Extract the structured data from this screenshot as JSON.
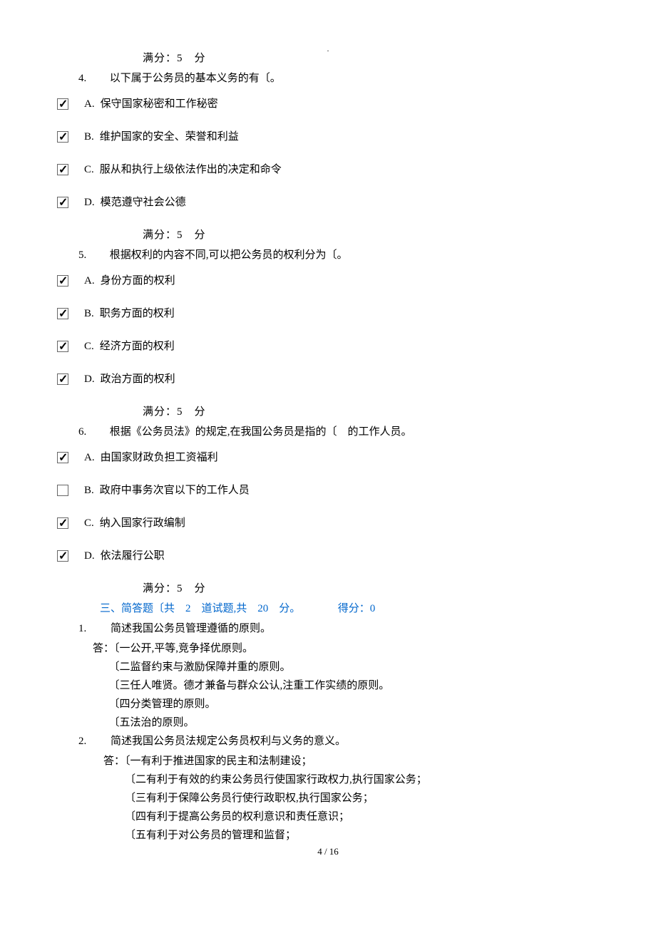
{
  "topDot": ".",
  "questions": [
    {
      "scoreLine": "满分：5　分",
      "num": "4.",
      "text": "以下属于公务员的基本义务的有〔。",
      "options": [
        {
          "checked": true,
          "letter": "A.",
          "text": "保守国家秘密和工作秘密"
        },
        {
          "checked": true,
          "letter": "B.",
          "text": "维护国家的安全、荣誉和利益"
        },
        {
          "checked": true,
          "letter": "C.",
          "text": "服从和执行上级依法作出的决定和命令"
        },
        {
          "checked": true,
          "letter": "D.",
          "text": "模范遵守社会公德"
        }
      ]
    },
    {
      "scoreLine": "满分：5　分",
      "num": "5.",
      "text": "根据权利的内容不同,可以把公务员的权利分为〔。",
      "options": [
        {
          "checked": true,
          "letter": "A.",
          "text": "身份方面的权利"
        },
        {
          "checked": true,
          "letter": "B.",
          "text": "职务方面的权利"
        },
        {
          "checked": true,
          "letter": "C.",
          "text": "经济方面的权利"
        },
        {
          "checked": true,
          "letter": "D.",
          "text": "政治方面的权利"
        }
      ]
    },
    {
      "scoreLine": "满分：5　分",
      "num": "6.",
      "text": "根据《公务员法》的规定,在我国公务员是指的〔　的工作人员。",
      "options": [
        {
          "checked": true,
          "letter": "A.",
          "text": "由国家财政负担工资福利"
        },
        {
          "checked": false,
          "letter": "B.",
          "text": "政府中事务次官以下的工作人员"
        },
        {
          "checked": true,
          "letter": "C.",
          "text": "纳入国家行政编制"
        },
        {
          "checked": true,
          "letter": "D.",
          "text": "依法履行公职"
        }
      ]
    }
  ],
  "finalScore": "满分：5　分",
  "section3": {
    "title": "三、简答题〔共　2　道试题,共　20　分。　　　　得分：0",
    "answers": [
      {
        "num": "1.",
        "q": "简述我国公务员管理遵循的原则。",
        "lines": [
          "答：〔一公开,平等,竞争择优原则。",
          "　　〔二监督约束与激励保障并重的原则。",
          "　　〔三任人唯贤。德才兼备与群众公认,注重工作实绩的原则。",
          "　　〔四分类管理的原则。",
          "　　〔五法治的原则。"
        ]
      },
      {
        "num": "2.",
        "q": "简述我国公务员法规定公务员权利与义务的意义。",
        "firstLine": "答：〔一有利于推进国家的民主和法制建设；",
        "indentLines": [
          "〔二有利于有效的约束公务员行使国家行政权力,执行国家公务；",
          "〔三有利于保障公务员行使行政职权,执行国家公务；",
          "〔四有利于提高公务员的权利意识和责任意识；",
          "〔五有利于对公务员的管理和监督；"
        ]
      }
    ]
  },
  "pageNum": "4 / 16"
}
